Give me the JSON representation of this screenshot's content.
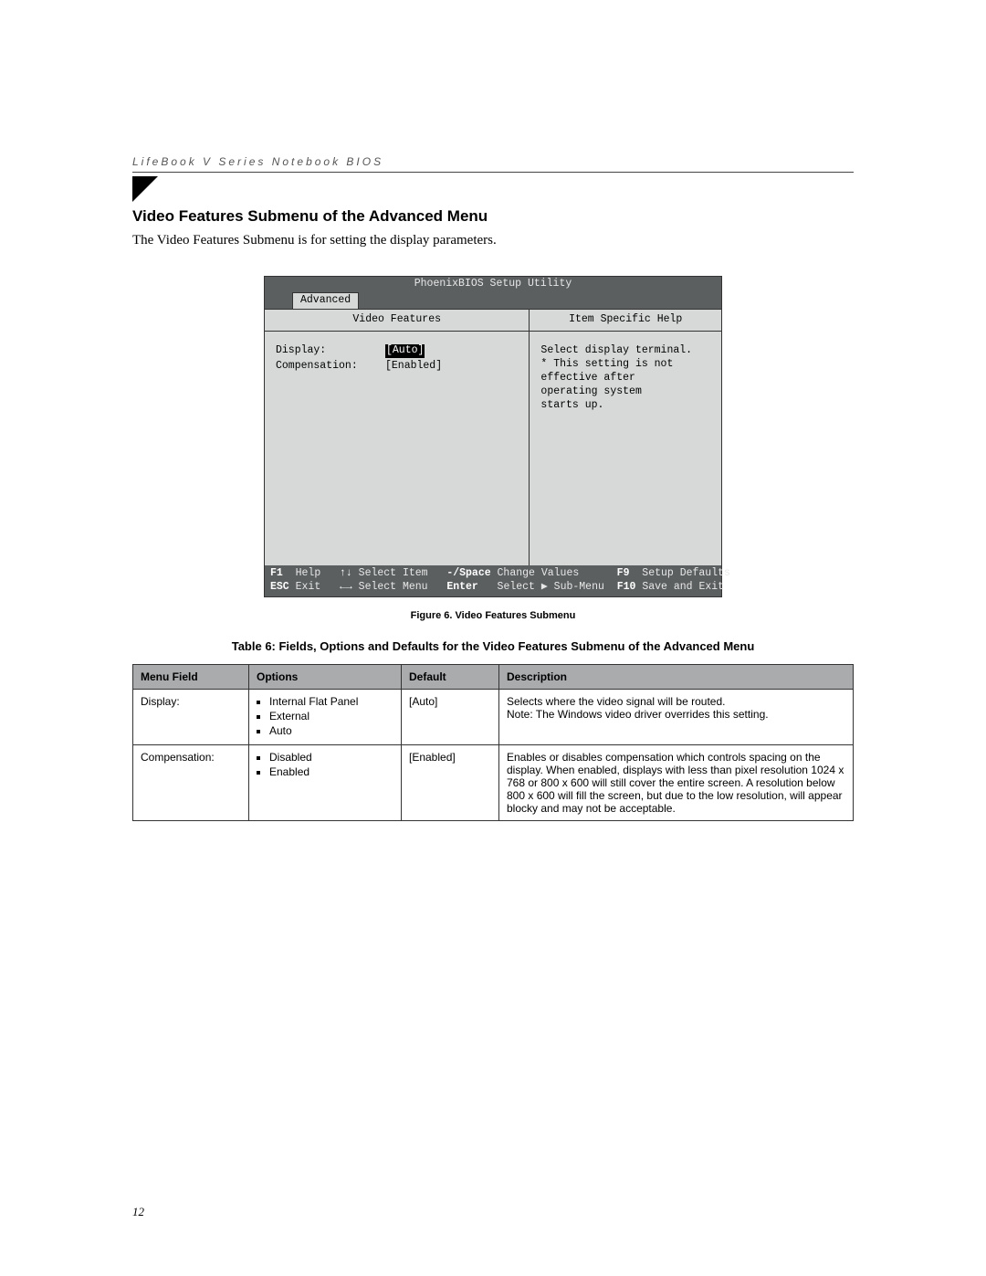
{
  "header": "LifeBook V Series Notebook BIOS",
  "heading": "Video Features Submenu of the Advanced Menu",
  "intro": "The Video Features Submenu is for setting the display parameters.",
  "bios": {
    "title": "PhoenixBIOS Setup Utility",
    "tab": "Advanced",
    "left_title": "Video Features",
    "right_title": "Item Specific Help",
    "fields": [
      {
        "label": "Display:",
        "value": "[Auto]",
        "selected": true
      },
      {
        "label": "Compensation:",
        "value": "[Enabled]",
        "selected": false
      }
    ],
    "help_lines": [
      "Select display terminal.",
      "",
      "* This setting is not",
      "effective after",
      "operating system",
      "starts up."
    ],
    "footer": {
      "r1": {
        "k1": "F1",
        "a1": "Help",
        "k2": "↑↓",
        "a2": "Select Item",
        "k3": "-/Space",
        "a3": "Change Values",
        "k4": "F9",
        "a4": "Setup Defaults"
      },
      "r2": {
        "k1": "ESC",
        "a1": "Exit",
        "k2": "←→",
        "a2": "Select Menu",
        "k3": "Enter",
        "a3": "Select ▶ Sub-Menu",
        "k4": "F10",
        "a4": "Save and Exit"
      }
    }
  },
  "figure_caption": "Figure 6.  Video Features Submenu",
  "table_caption": "Table 6: Fields, Options and Defaults for the Video Features Submenu of the Advanced Menu",
  "table": {
    "headers": [
      "Menu Field",
      "Options",
      "Default",
      "Description"
    ],
    "rows": [
      {
        "field": "Display:",
        "options": [
          "Internal Flat Panel",
          "External",
          "Auto"
        ],
        "default": "[Auto]",
        "desc": "Selects where the video signal will be routed.\nNote: The Windows video driver overrides this setting."
      },
      {
        "field": "Compensation:",
        "options": [
          "Disabled",
          "Enabled"
        ],
        "default": "[Enabled]",
        "desc": "Enables or disables compensation which controls spacing on the display. When enabled, displays with less than pixel resolution 1024 x 768 or 800 x 600 will still cover the entire screen. A resolution below 800 x 600 will fill the screen, but due to the low resolution, will appear blocky and may not be acceptable."
      }
    ]
  },
  "page_number": "12"
}
